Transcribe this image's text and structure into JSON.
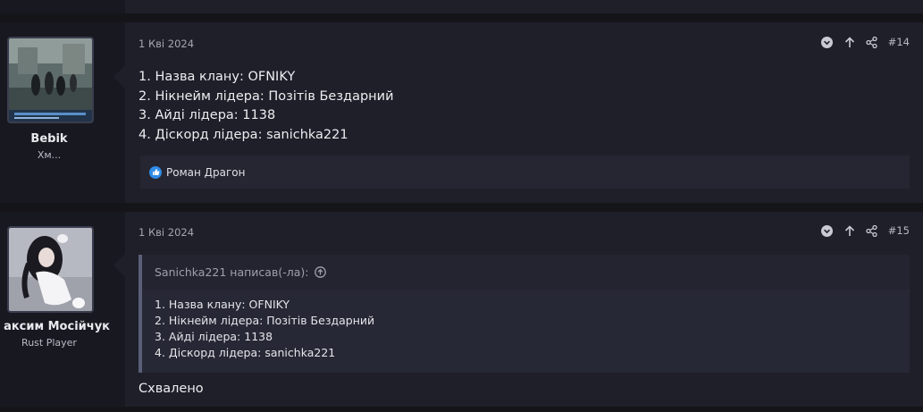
{
  "posts": [
    {
      "user": {
        "name": "Bebik",
        "title": "Хм..."
      },
      "date": "1 Кві 2024",
      "number": "#14",
      "lines": [
        "1. Назва клану: OFNIKY",
        "2. Нікнейм лідера: Позітів Бездарний",
        "3. Айді лідера: 1138",
        "4. Діскорд лідера: sanichka221"
      ],
      "reaction_user": "Роман Драгон"
    },
    {
      "user": {
        "name": "аксим Мосійчук",
        "title": "Rust Player"
      },
      "date": "1 Кві 2024",
      "number": "#15",
      "quote": {
        "author": "Sanichka221 написав(-ла):",
        "lines": [
          "1. Назва клану: OFNIKY",
          "2. Нікнейм лідера: Позітів Бездарний",
          "3. Айді лідера: 1138",
          "4. Діскорд лідера: sanichka221"
        ]
      },
      "text": "Схвалено"
    }
  ],
  "colors": {
    "accent_like": "#2f8ce6",
    "background": "#141419",
    "post_bg": "#1e1f28"
  },
  "icons": [
    "chevron-down-circle-icon",
    "arrow-up-icon",
    "share-icon",
    "like-icon",
    "arrow-up-circle-icon"
  ]
}
